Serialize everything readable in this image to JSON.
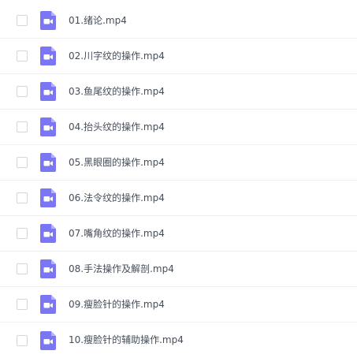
{
  "files": [
    {
      "name": "01.绪论.mp4",
      "icon": "video-file-icon"
    },
    {
      "name": "02.川字纹的操作.mp4",
      "icon": "video-file-icon"
    },
    {
      "name": "03.鱼尾纹的操作.mp4",
      "icon": "video-file-icon"
    },
    {
      "name": "04.抬头纹的操作.mp4",
      "icon": "video-file-icon"
    },
    {
      "name": "05.黑眼圈的操作.mp4",
      "icon": "video-file-icon"
    },
    {
      "name": "06.法令纹的操作.mp4",
      "icon": "video-file-icon"
    },
    {
      "name": "07.嘴角纹的操作.mp4",
      "icon": "video-file-icon"
    },
    {
      "name": "08.手法操作及解剖.mp4",
      "icon": "video-file-icon"
    },
    {
      "name": "09.瘦脸针的操作.mp4",
      "icon": "video-file-icon"
    },
    {
      "name": "10.瘦脸针的辅助操作.mp4",
      "icon": "video-file-icon"
    }
  ],
  "colors": {
    "icon_fill": "#7b76f3",
    "icon_fold": "#b5b2fa",
    "text": "#454d5a",
    "divider": "#eef0f3",
    "checkbox_border": "#d2d6dd"
  }
}
